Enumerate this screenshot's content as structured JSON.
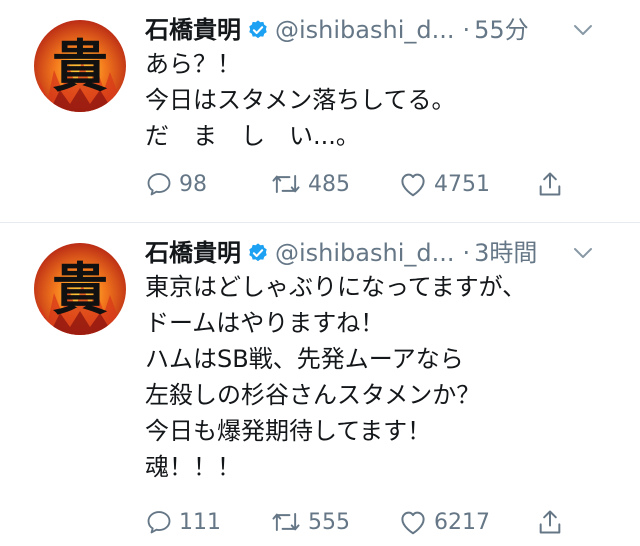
{
  "tweets": [
    {
      "name": "石橋貴明",
      "handle": "@ishibashi_d...",
      "separator": "·",
      "time": "55分",
      "avatar_char": "貴",
      "lines": [
        "あら？！",
        "今日はスタメン落ちしてる。",
        "だ　ま　し　い...。"
      ],
      "replies": "98",
      "retweets": "485",
      "likes": "4751"
    },
    {
      "name": "石橋貴明",
      "handle": "@ishibashi_d...",
      "separator": "·",
      "time": "3時間",
      "avatar_char": "貴",
      "lines": [
        "東京はどしゃぶりになってますが、",
        "ドームはやりますね！",
        "ハムはSB戦、先発ムーアなら",
        "左殺しの杉谷さんスタメンか？",
        "今日も爆発期待してます！",
        "魂！！！"
      ],
      "replies": "111",
      "retweets": "555",
      "likes": "6217"
    }
  ],
  "icons": {
    "verified": "verified-badge-icon",
    "caret": "chevron-down-icon",
    "reply": "reply-icon",
    "retweet": "retweet-icon",
    "like": "heart-icon",
    "share": "share-icon"
  },
  "colors": {
    "verified_blue": "#1da1f2",
    "muted_gray": "#657786",
    "text": "#14171a",
    "divider": "#e6ecf0",
    "avatar_fire_red": "#c8271b",
    "avatar_fire_orange": "#f47a1d"
  }
}
